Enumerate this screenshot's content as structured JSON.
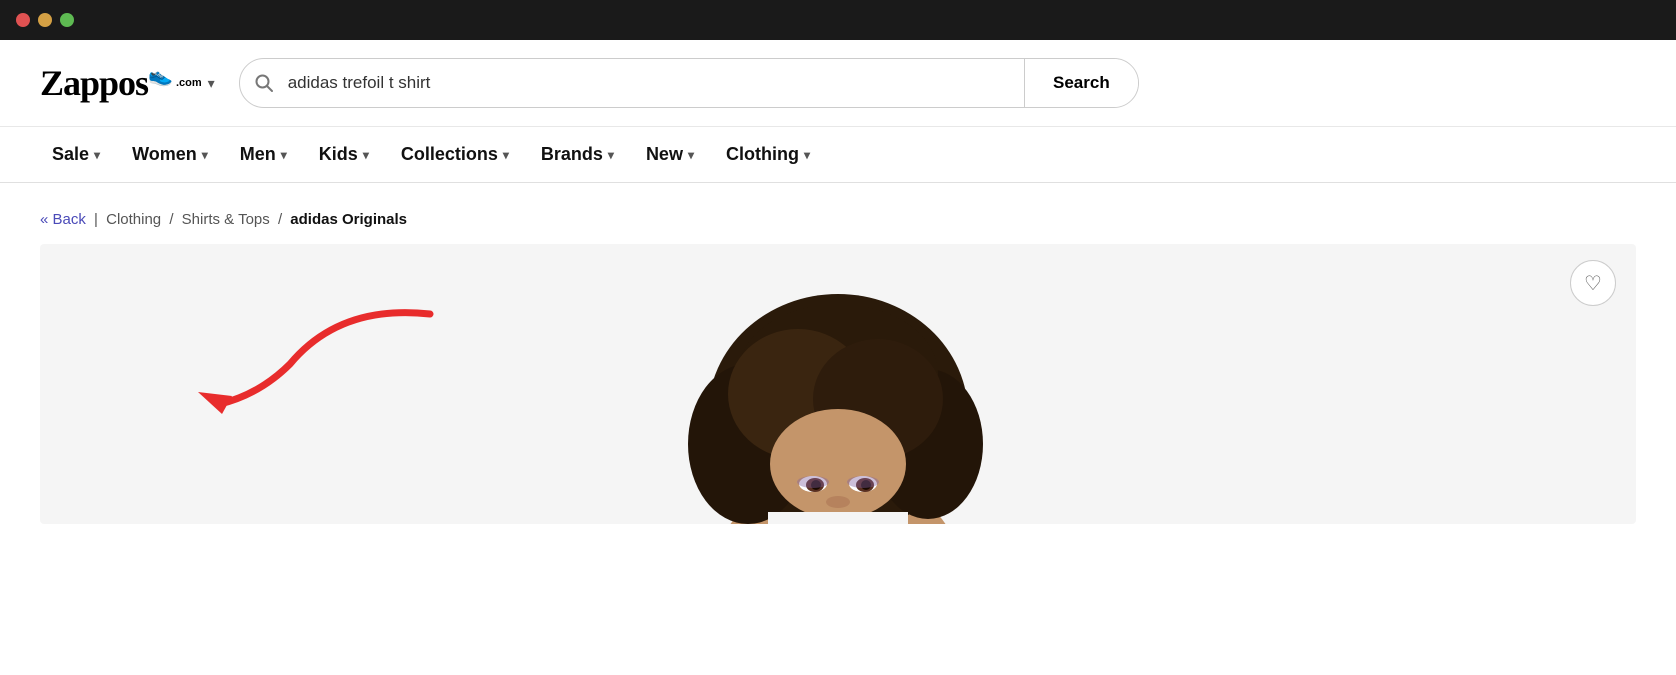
{
  "titlebar": {
    "traffic_lights": [
      "red",
      "yellow",
      "green"
    ]
  },
  "header": {
    "logo": {
      "text": "Zappos",
      "com": ".com",
      "chevron": "▾"
    },
    "search": {
      "placeholder": "",
      "value": "adidas trefoil t shirt",
      "button_label": "Search",
      "icon": "🔍"
    }
  },
  "nav": {
    "items": [
      {
        "label": "Sale",
        "has_chevron": true
      },
      {
        "label": "Women",
        "has_chevron": true
      },
      {
        "label": "Men",
        "has_chevron": true
      },
      {
        "label": "Kids",
        "has_chevron": true
      },
      {
        "label": "Collections",
        "has_chevron": true
      },
      {
        "label": "Brands",
        "has_chevron": true
      },
      {
        "label": "New",
        "has_chevron": true
      },
      {
        "label": "Clothing",
        "has_chevron": true
      }
    ]
  },
  "breadcrumb": {
    "back_label": "« Back",
    "separator": "|",
    "links": [
      {
        "label": "Clothing",
        "href": "#"
      },
      {
        "label": "Shirts & Tops",
        "href": "#"
      }
    ],
    "current": "adidas Originals"
  },
  "product": {
    "heart_icon": "♡"
  }
}
